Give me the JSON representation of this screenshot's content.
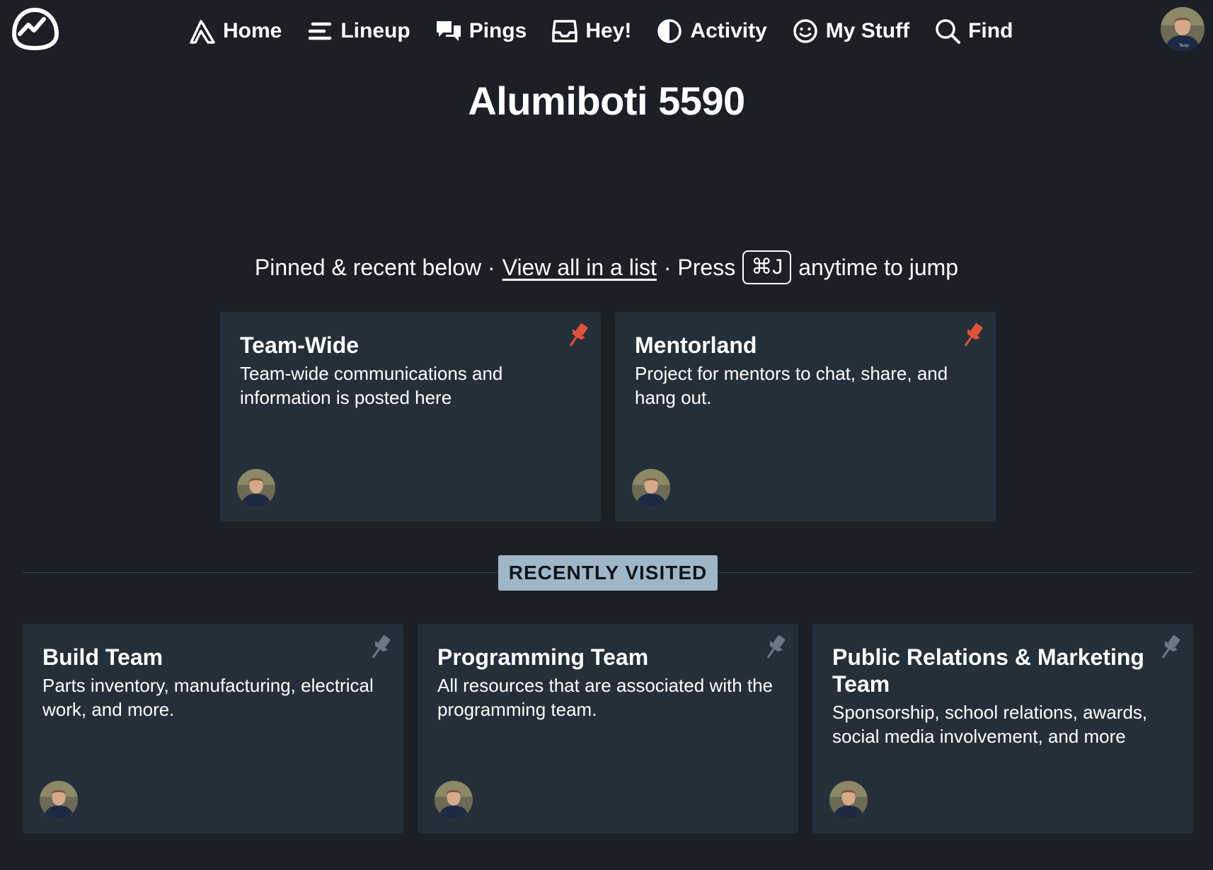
{
  "nav": {
    "items": [
      {
        "label": "Home",
        "icon": "mountain-icon"
      },
      {
        "label": "Lineup",
        "icon": "lineup-icon"
      },
      {
        "label": "Pings",
        "icon": "chat-bubbles-icon"
      },
      {
        "label": "Hey!",
        "icon": "inbox-tray-icon"
      },
      {
        "label": "Activity",
        "icon": "pie-clock-icon"
      },
      {
        "label": "My Stuff",
        "icon": "smiley-icon"
      },
      {
        "label": "Find",
        "icon": "search-icon"
      }
    ]
  },
  "page": {
    "title": "Alumiboti 5590"
  },
  "hint": {
    "prefix": "Pinned & recent below ·",
    "link": "View all in a list",
    "middle": "· Press",
    "shortcut": "⌘J",
    "suffix": "anytime to jump"
  },
  "pinned": [
    {
      "title": "Team-Wide",
      "description": "Team-wide communications and information is posted here"
    },
    {
      "title": "Mentorland",
      "description": "Project for mentors to chat, share, and hang out."
    }
  ],
  "recent": {
    "label": "RECENTLY VISITED",
    "items": [
      {
        "title": "Build Team",
        "description": "Parts inventory, manufacturing, electrical work, and more."
      },
      {
        "title": "Programming Team",
        "description": "All resources that are associated with the programming team."
      },
      {
        "title": "Public Relations & Marketing Team",
        "description": "Sponsorship, school relations, awards, social media involvement, and more"
      }
    ]
  },
  "colors": {
    "background": "#1b2027",
    "card": "#252f3a",
    "pin_active": "#e0533a",
    "pin_inactive": "#6c7886",
    "badge": "#9fb6c9"
  }
}
